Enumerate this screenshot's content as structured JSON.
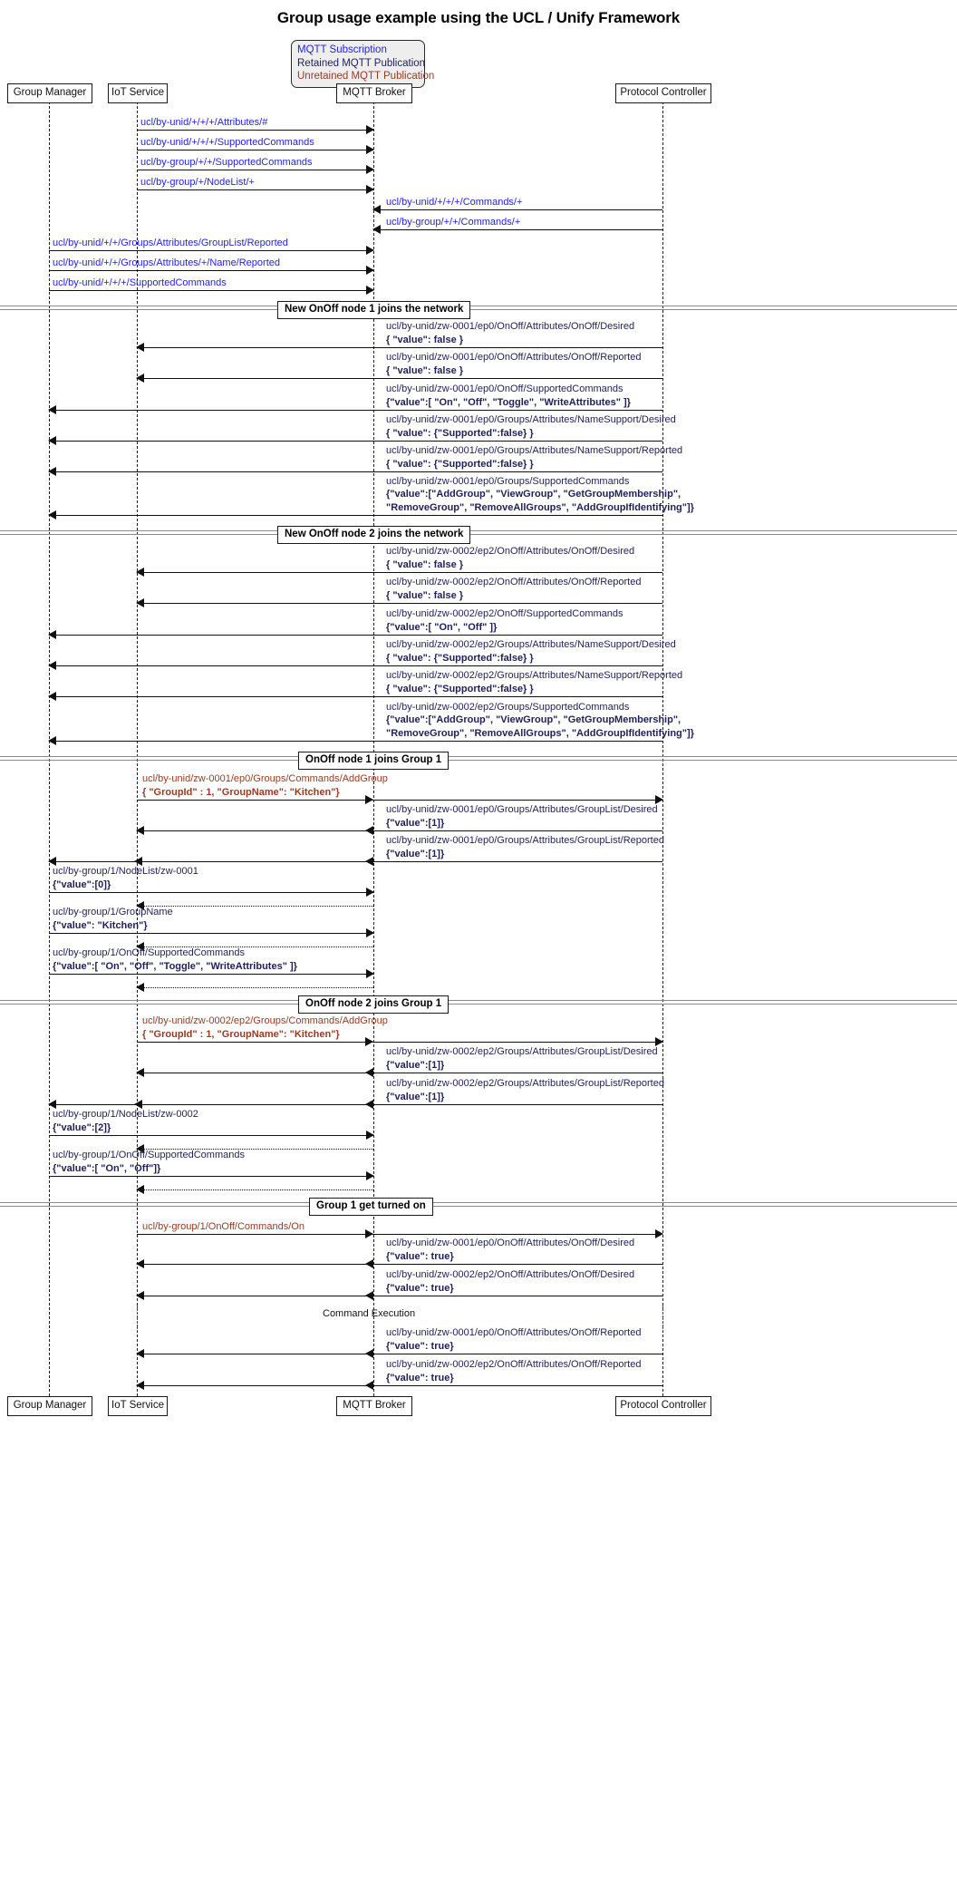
{
  "title": "Group usage example using the UCL / Unify Framework",
  "legend": {
    "subscription": "MQTT Subscription",
    "retained": "Retained MQTT Publication",
    "unretained": "Unretained MQTT Publication",
    "colors": {
      "subscription": "#2222ee",
      "retained": "#1f1f5c",
      "unretained": "#9c3a20"
    }
  },
  "participants": [
    {
      "id": "gm",
      "name": "Group Manager"
    },
    {
      "id": "iot",
      "name": "IoT Service"
    },
    {
      "id": "broker",
      "name": "MQTT Broker"
    },
    {
      "id": "pc",
      "name": "Protocol Controller"
    }
  ],
  "separators": [
    {
      "label": "New OnOff node 1 joins the network"
    },
    {
      "label": "New OnOff node 2 joins the network"
    },
    {
      "label": "OnOff node 1 joins Group 1"
    },
    {
      "label": "OnOff node 2 joins Group 1"
    },
    {
      "label": "Group 1 get turned on"
    }
  ],
  "free_text": {
    "command_execution": "Command Execution"
  },
  "messages": [
    {
      "id": "m1",
      "l1": "ucl/by-unid/+/+/+/Attributes/#",
      "l2": "",
      "l3": "",
      "kind": "subscription"
    },
    {
      "id": "m2",
      "l1": "ucl/by-unid/+/+/+/SupportedCommands",
      "l2": "",
      "l3": "",
      "kind": "subscription"
    },
    {
      "id": "m3",
      "l1": "ucl/by-group/+/+/SupportedCommands",
      "l2": "",
      "l3": "",
      "kind": "subscription"
    },
    {
      "id": "m4",
      "l1": "ucl/by-group/+/NodeList/+",
      "l2": "",
      "l3": "",
      "kind": "subscription"
    },
    {
      "id": "m5",
      "l1": "ucl/by-unid/+/+/+/Commands/+",
      "l2": "",
      "l3": "",
      "kind": "subscription"
    },
    {
      "id": "m6",
      "l1": "ucl/by-group/+/+/Commands/+",
      "l2": "",
      "l3": "",
      "kind": "subscription"
    },
    {
      "id": "m7",
      "l1": "ucl/by-unid/+/+/Groups/Attributes/GroupList/Reported",
      "l2": "",
      "l3": "",
      "kind": "subscription"
    },
    {
      "id": "m8",
      "l1": "ucl/by-unid/+/+/Groups/Attributes/+/Name/Reported",
      "l2": "",
      "l3": "",
      "kind": "subscription"
    },
    {
      "id": "m9",
      "l1": "ucl/by-unid/+/+/+/SupportedCommands",
      "l2": "",
      "l3": "",
      "kind": "subscription"
    },
    {
      "id": "m10",
      "l1": "ucl/by-unid/zw-0001/ep0/OnOff/Attributes/OnOff/Desired",
      "l2": "{ \"value\": false }",
      "l3": "",
      "kind": "retained"
    },
    {
      "id": "m11",
      "l1": "ucl/by-unid/zw-0001/ep0/OnOff/Attributes/OnOff/Reported",
      "l2": "{ \"value\": false }",
      "l3": "",
      "kind": "retained"
    },
    {
      "id": "m12",
      "l1": "ucl/by-unid/zw-0001/ep0/OnOff/SupportedCommands",
      "l2": "{\"value\":[ \"On\", \"Off\", \"Toggle\", \"WriteAttributes\" ]}",
      "l3": "",
      "kind": "retained"
    },
    {
      "id": "m13",
      "l1": "ucl/by-unid/zw-0001/ep0/Groups/Attributes/NameSupport/Desired",
      "l2": "{ \"value\": {\"Supported\":false} }",
      "l3": "",
      "kind": "retained"
    },
    {
      "id": "m14",
      "l1": "ucl/by-unid/zw-0001/ep0/Groups/Attributes/NameSupport/Reported",
      "l2": "{ \"value\": {\"Supported\":false} }",
      "l3": "",
      "kind": "retained"
    },
    {
      "id": "m15",
      "l1": "ucl/by-unid/zw-0001/ep0/Groups/SupportedCommands",
      "l2": "{\"value\":[\"AddGroup\", \"ViewGroup\", \"GetGroupMembership\",",
      "l3": "\"RemoveGroup\", \"RemoveAllGroups\", \"AddGroupIfIdentifying\"]}",
      "kind": "retained"
    },
    {
      "id": "m16",
      "l1": "ucl/by-unid/zw-0002/ep2/OnOff/Attributes/OnOff/Desired",
      "l2": "{ \"value\": false }",
      "l3": "",
      "kind": "retained"
    },
    {
      "id": "m17",
      "l1": "ucl/by-unid/zw-0002/ep2/OnOff/Attributes/OnOff/Reported",
      "l2": "{ \"value\": false }",
      "l3": "",
      "kind": "retained"
    },
    {
      "id": "m18",
      "l1": "ucl/by-unid/zw-0002/ep2/OnOff/SupportedCommands",
      "l2": "{\"value\":[ \"On\", \"Off\" ]}",
      "l3": "",
      "kind": "retained"
    },
    {
      "id": "m19",
      "l1": "ucl/by-unid/zw-0002/ep2/Groups/Attributes/NameSupport/Desired",
      "l2": "{ \"value\": {\"Supported\":false} }",
      "l3": "",
      "kind": "retained"
    },
    {
      "id": "m20",
      "l1": "ucl/by-unid/zw-0002/ep2/Groups/Attributes/NameSupport/Reported",
      "l2": "{ \"value\": {\"Supported\":false} }",
      "l3": "",
      "kind": "retained"
    },
    {
      "id": "m21",
      "l1": "ucl/by-unid/zw-0002/ep2/Groups/SupportedCommands",
      "l2": "{\"value\":[\"AddGroup\", \"ViewGroup\", \"GetGroupMembership\",",
      "l3": "\"RemoveGroup\", \"RemoveAllGroups\", \"AddGroupIfIdentifying\"]}",
      "kind": "retained"
    },
    {
      "id": "m22",
      "l1": "ucl/by-unid/zw-0001/ep0/Groups/Commands/AddGroup",
      "l2": "{ \"GroupId\" : 1, \"GroupName\": \"Kitchen\"}",
      "l3": "",
      "kind": "unretained"
    },
    {
      "id": "m23",
      "l1": "ucl/by-unid/zw-0001/ep0/Groups/Attributes/GroupList/Desired",
      "l2": "{\"value\":[1]}",
      "l3": "",
      "kind": "retained"
    },
    {
      "id": "m24",
      "l1": "ucl/by-unid/zw-0001/ep0/Groups/Attributes/GroupList/Reported",
      "l2": "{\"value\":[1]}",
      "l3": "",
      "kind": "retained"
    },
    {
      "id": "m25",
      "l1": "ucl/by-group/1/NodeList/zw-0001",
      "l2": "{\"value\":[0]}",
      "l3": "",
      "kind": "retained"
    },
    {
      "id": "m26",
      "l1": "ucl/by-group/1/GroupName",
      "l2": "{\"value\": \"Kitchen\"}",
      "l3": "",
      "kind": "retained"
    },
    {
      "id": "m27",
      "l1": "ucl/by-group/1/OnOff/SupportedCommands",
      "l2": "{\"value\":[ \"On\", \"Off\", \"Toggle\", \"WriteAttributes\" ]}",
      "l3": "",
      "kind": "retained"
    },
    {
      "id": "m28",
      "l1": "ucl/by-unid/zw-0002/ep2/Groups/Commands/AddGroup",
      "l2": "{ \"GroupId\" : 1, \"GroupName\": \"Kitchen\"}",
      "l3": "",
      "kind": "unretained"
    },
    {
      "id": "m29",
      "l1": "ucl/by-unid/zw-0002/ep2/Groups/Attributes/GroupList/Desired",
      "l2": "{\"value\":[1]}",
      "l3": "",
      "kind": "retained"
    },
    {
      "id": "m30",
      "l1": "ucl/by-unid/zw-0002/ep2/Groups/Attributes/GroupList/Reported",
      "l2": "{\"value\":[1]}",
      "l3": "",
      "kind": "retained"
    },
    {
      "id": "m31",
      "l1": "ucl/by-group/1/NodeList/zw-0002",
      "l2": "{\"value\":[2]}",
      "l3": "",
      "kind": "retained"
    },
    {
      "id": "m32",
      "l1": "ucl/by-group/1/OnOff/SupportedCommands",
      "l2": "{\"value\":[ \"On\", \"Off\"]}",
      "l3": "",
      "kind": "retained"
    },
    {
      "id": "m33",
      "l1": "ucl/by-group/1/OnOff/Commands/On",
      "l2": "",
      "l3": "",
      "kind": "unretained"
    },
    {
      "id": "m34",
      "l1": "ucl/by-unid/zw-0001/ep0/OnOff/Attributes/OnOff/Desired",
      "l2": "{\"value\": true}",
      "l3": "",
      "kind": "retained"
    },
    {
      "id": "m35",
      "l1": "ucl/by-unid/zw-0002/ep2/OnOff/Attributes/OnOff/Desired",
      "l2": "{\"value\": true}",
      "l3": "",
      "kind": "retained"
    },
    {
      "id": "m36",
      "l1": "ucl/by-unid/zw-0001/ep0/OnOff/Attributes/OnOff/Reported",
      "l2": "{\"value\": true}",
      "l3": "",
      "kind": "retained"
    },
    {
      "id": "m37",
      "l1": "ucl/by-unid/zw-0002/ep2/OnOff/Attributes/OnOff/Reported",
      "l2": "{\"value\": true}",
      "l3": "",
      "kind": "retained"
    }
  ]
}
